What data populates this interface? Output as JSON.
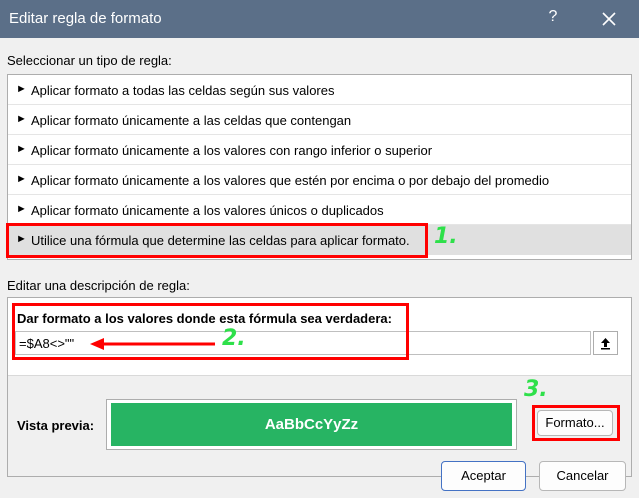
{
  "window": {
    "title": "Editar regla de formato",
    "help_label": "?"
  },
  "rule_type": {
    "label": "Seleccionar un tipo de regla:",
    "items": [
      {
        "label": "Aplicar formato a todas las celdas según sus valores",
        "selected": false
      },
      {
        "label": "Aplicar formato únicamente a las celdas que contengan",
        "selected": false
      },
      {
        "label": "Aplicar formato únicamente a los valores con rango inferior o superior",
        "selected": false
      },
      {
        "label": "Aplicar formato únicamente a los valores que estén por encima o por debajo del promedio",
        "selected": false
      },
      {
        "label": "Aplicar formato únicamente a los valores únicos o duplicados",
        "selected": false
      },
      {
        "label": "Utilice una fórmula que determine las celdas para aplicar formato.",
        "selected": true
      }
    ],
    "arrow_glyph": "►"
  },
  "description": {
    "label": "Editar una descripción de regla:",
    "formula_label": "Dar formato a los valores donde esta fórmula sea verdadera:",
    "formula_value": "=$A8<>\"\"",
    "preview_label": "Vista previa:",
    "preview_text": "AaBbCcYyZz",
    "preview_color": "#27b463",
    "format_button": "Formato..."
  },
  "footer": {
    "accept_button": "Aceptar",
    "cancel_button": "Cancelar"
  },
  "annotations": {
    "color_box": "#ff0000",
    "color_number": "#2ee04a",
    "numbers": [
      "1.",
      "2.",
      "3."
    ]
  }
}
